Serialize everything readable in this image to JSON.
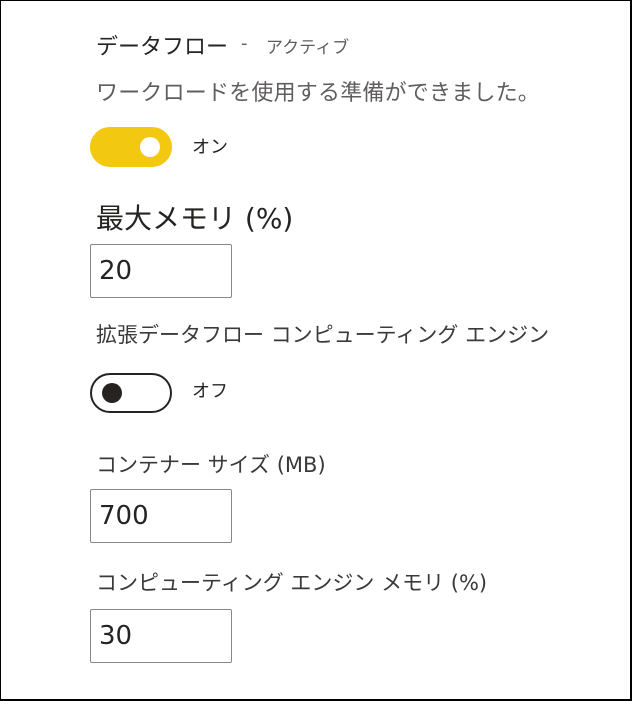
{
  "workload": {
    "title": "データフロー",
    "separator": "-",
    "status": "アクティブ",
    "description": "ワークロードを使用する準備ができました。",
    "toggle_label": "オン",
    "enabled": true
  },
  "max_memory": {
    "label": "最大メモリ (%)",
    "value": "20"
  },
  "enhanced_engine": {
    "label": "拡張データフロー コンピューティング エンジン",
    "toggle_label": "オフ",
    "enabled": false
  },
  "container_size": {
    "label": "コンテナー サイズ (MB)",
    "value": "700"
  },
  "engine_memory": {
    "label": "コンピューティング エンジン メモリ (%)",
    "value": "30"
  },
  "colors": {
    "toggle_on": "#f2c811",
    "text_primary": "#252423",
    "text_secondary": "#605e5c",
    "input_border": "#8a8886"
  }
}
